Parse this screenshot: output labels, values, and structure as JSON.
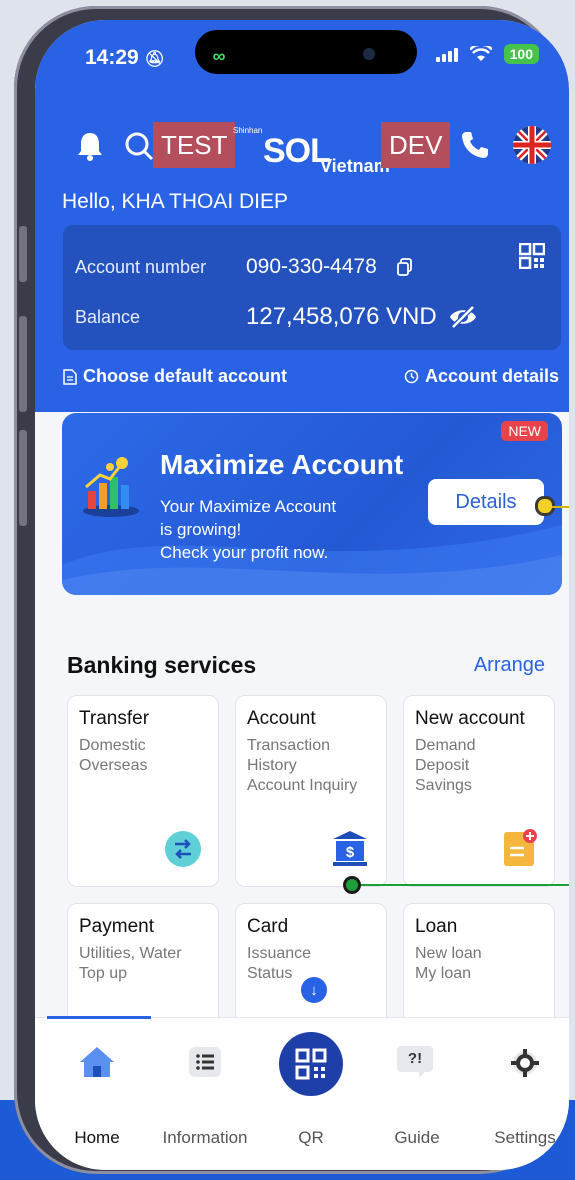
{
  "status_bar": {
    "time": "14:29",
    "battery": "100"
  },
  "header": {
    "test_tag": "TEST",
    "logo_small": "Shinhan",
    "logo_main": "SOL",
    "logo_country": "Vietnam",
    "dev_tag": "DEV",
    "greeting": "Hello, KHA THOAI DIEP"
  },
  "account": {
    "number_label": "Account number",
    "number_value": "090-330-4478",
    "balance_label": "Balance",
    "balance_value": "127,458,076",
    "currency": "VND"
  },
  "links": {
    "default_account": "Choose default account",
    "account_details": "Account details"
  },
  "promo": {
    "badge": "NEW",
    "title": "Maximize Account",
    "line1": "Your Maximize Account",
    "line2": "is growing!",
    "line3": "Check your profit now.",
    "button": "Details"
  },
  "services": {
    "title": "Banking services",
    "arrange": "Arrange",
    "tiles": [
      {
        "title": "Transfer",
        "lines": [
          "Domestic",
          "Overseas"
        ]
      },
      {
        "title": "Account",
        "lines": [
          "Transaction",
          "History",
          "Account Inquiry"
        ]
      },
      {
        "title": "New account",
        "lines": [
          "Demand",
          "Deposit",
          "Savings"
        ]
      },
      {
        "title": "Payment",
        "lines": [
          "Utilities, Water",
          "Top up"
        ]
      },
      {
        "title": "Card",
        "lines": [
          "Issuance",
          "Status"
        ]
      },
      {
        "title": "Loan",
        "lines": [
          "New loan",
          "My loan"
        ]
      }
    ]
  },
  "tabbar": {
    "tabs": [
      {
        "label": "Home",
        "icon": "home-icon"
      },
      {
        "label": "Information",
        "icon": "list-icon"
      },
      {
        "label": "QR",
        "icon": "qr-icon"
      },
      {
        "label": "Guide",
        "icon": "help-chat-icon"
      },
      {
        "label": "Settings",
        "icon": "gear-icon"
      }
    ],
    "guide_glyph": "?!"
  },
  "colors": {
    "primary": "#2a62e6",
    "dark_blue": "#1f3fa8",
    "tag_red": "#b34e5c",
    "new_badge": "#e8434b"
  }
}
